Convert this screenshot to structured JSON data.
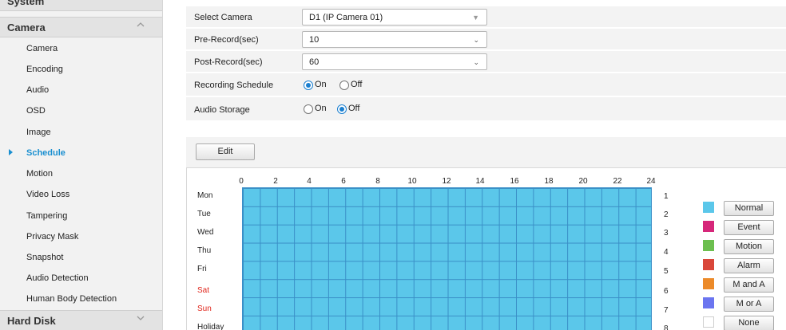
{
  "sidebar": {
    "sections": [
      {
        "label": "System",
        "expanded": false
      },
      {
        "label": "Camera",
        "expanded": true
      },
      {
        "label": "Hard Disk",
        "expanded": false
      }
    ],
    "camera_items": [
      {
        "label": "Camera"
      },
      {
        "label": "Encoding"
      },
      {
        "label": "Audio"
      },
      {
        "label": "OSD"
      },
      {
        "label": "Image"
      },
      {
        "label": "Schedule",
        "active": true
      },
      {
        "label": "Motion"
      },
      {
        "label": "Video Loss"
      },
      {
        "label": "Tampering"
      },
      {
        "label": "Privacy Mask"
      },
      {
        "label": "Snapshot"
      },
      {
        "label": "Audio Detection"
      },
      {
        "label": "Human Body Detection"
      }
    ]
  },
  "form": {
    "select_camera": {
      "label": "Select Camera",
      "value": "D1 (IP Camera 01)"
    },
    "pre_record": {
      "label": "Pre-Record(sec)",
      "value": "10"
    },
    "post_record": {
      "label": "Post-Record(sec)",
      "value": "60"
    },
    "recording_schedule": {
      "label": "Recording Schedule",
      "on_label": "On",
      "off_label": "Off",
      "selected": "On"
    },
    "audio_storage": {
      "label": "Audio Storage",
      "on_label": "On",
      "off_label": "Off",
      "selected": "Off"
    }
  },
  "schedule": {
    "edit_label": "Edit",
    "hour_ticks": [
      "0",
      "2",
      "4",
      "6",
      "8",
      "10",
      "12",
      "14",
      "16",
      "18",
      "20",
      "22",
      "24"
    ],
    "days": [
      {
        "label": "Mon",
        "num": "1",
        "weekend": false
      },
      {
        "label": "Tue",
        "num": "2",
        "weekend": false
      },
      {
        "label": "Wed",
        "num": "3",
        "weekend": false
      },
      {
        "label": "Thu",
        "num": "4",
        "weekend": false
      },
      {
        "label": "Fri",
        "num": "5",
        "weekend": false
      },
      {
        "label": "Sat",
        "num": "6",
        "weekend": true
      },
      {
        "label": "Sun",
        "num": "7",
        "weekend": true
      },
      {
        "label": "Holiday",
        "num": "8",
        "weekend": false
      }
    ],
    "fill_type": "Normal",
    "fill_color": "#5bc7ea"
  },
  "legend": [
    {
      "label": "Normal",
      "color": "#5bc7ea"
    },
    {
      "label": "Event",
      "color": "#d6277a"
    },
    {
      "label": "Motion",
      "color": "#6cbf4f"
    },
    {
      "label": "Alarm",
      "color": "#d9473a"
    },
    {
      "label": "M and A",
      "color": "#ec8a2a"
    },
    {
      "label": "M or A",
      "color": "#6b75f0"
    },
    {
      "label": "None",
      "color": "#ffffff"
    }
  ]
}
